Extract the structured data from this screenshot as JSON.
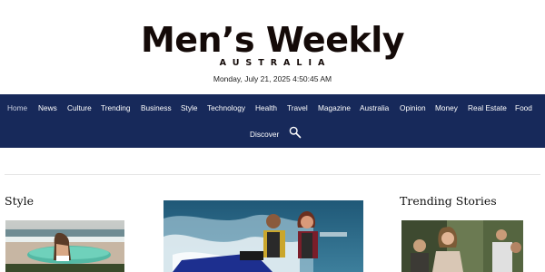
{
  "masthead": {
    "title": "Men’s Weekly",
    "subtitle": "AUSTRALIA",
    "date": "Monday, July 21, 2025 4:50:45 AM"
  },
  "nav": {
    "items": [
      {
        "label": "Home",
        "active": true
      },
      {
        "label": "News"
      },
      {
        "label": "Culture"
      },
      {
        "label": "Trending"
      },
      {
        "label": "Business"
      },
      {
        "label": "Style"
      },
      {
        "label": "Technology"
      },
      {
        "label": "Health"
      },
      {
        "label": "Travel"
      },
      {
        "label": "Magazine"
      },
      {
        "label": "Australia"
      },
      {
        "label": "Opinion"
      },
      {
        "label": "Money"
      },
      {
        "label": "Real Estate"
      },
      {
        "label": "Food"
      }
    ],
    "discover": "Discover",
    "search_icon": "search-icon"
  },
  "sections": {
    "style_heading": "Style",
    "trending_heading": "Trending Stories"
  },
  "colors": {
    "nav_background": "#17295a",
    "logo": "#140a08"
  }
}
